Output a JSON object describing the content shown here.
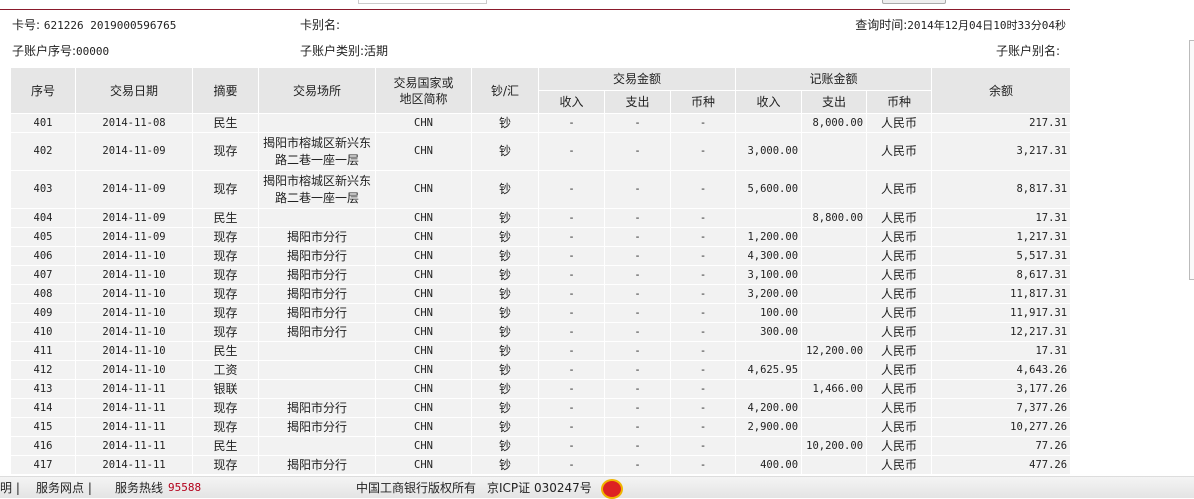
{
  "info": {
    "card_label": "卡号:",
    "card_no": "621226 2019000596765",
    "alias_label": "卡别名:",
    "query_time_label": "查询时间:",
    "query_time": "2014年12月04日10时33分04秒",
    "sub_no_label": "子账户序号:",
    "sub_no": "00000",
    "sub_type_label": "子账户类别:",
    "sub_type": "活期",
    "sub_alias_label": "子账户别名:"
  },
  "headers": {
    "seq": "序号",
    "date": "交易日期",
    "summary": "摘要",
    "place": "交易场所",
    "country": "交易国家或地区简称",
    "cash": "钞/汇",
    "trade_amount": "交易金额",
    "book_amount": "记账金额",
    "balance": "余额",
    "income": "收入",
    "expense": "支出",
    "currency": "币种"
  },
  "rows": [
    [
      "401",
      "2014-11-08",
      "民生",
      "",
      "CHN",
      "钞",
      "-",
      "-",
      "-",
      "",
      "8,000.00",
      "人民币",
      "217.31"
    ],
    [
      "402",
      "2014-11-09",
      "现存",
      "揭阳市榕城区新兴东路二巷一座一层",
      "CHN",
      "钞",
      "-",
      "-",
      "-",
      "3,000.00",
      "",
      "人民币",
      "3,217.31"
    ],
    [
      "403",
      "2014-11-09",
      "现存",
      "揭阳市榕城区新兴东路二巷一座一层",
      "CHN",
      "钞",
      "-",
      "-",
      "-",
      "5,600.00",
      "",
      "人民币",
      "8,817.31"
    ],
    [
      "404",
      "2014-11-09",
      "民生",
      "",
      "CHN",
      "钞",
      "-",
      "-",
      "-",
      "",
      "8,800.00",
      "人民币",
      "17.31"
    ],
    [
      "405",
      "2014-11-09",
      "现存",
      "揭阳市分行",
      "CHN",
      "钞",
      "-",
      "-",
      "-",
      "1,200.00",
      "",
      "人民币",
      "1,217.31"
    ],
    [
      "406",
      "2014-11-10",
      "现存",
      "揭阳市分行",
      "CHN",
      "钞",
      "-",
      "-",
      "-",
      "4,300.00",
      "",
      "人民币",
      "5,517.31"
    ],
    [
      "407",
      "2014-11-10",
      "现存",
      "揭阳市分行",
      "CHN",
      "钞",
      "-",
      "-",
      "-",
      "3,100.00",
      "",
      "人民币",
      "8,617.31"
    ],
    [
      "408",
      "2014-11-10",
      "现存",
      "揭阳市分行",
      "CHN",
      "钞",
      "-",
      "-",
      "-",
      "3,200.00",
      "",
      "人民币",
      "11,817.31"
    ],
    [
      "409",
      "2014-11-10",
      "现存",
      "揭阳市分行",
      "CHN",
      "钞",
      "-",
      "-",
      "-",
      "100.00",
      "",
      "人民币",
      "11,917.31"
    ],
    [
      "410",
      "2014-11-10",
      "现存",
      "揭阳市分行",
      "CHN",
      "钞",
      "-",
      "-",
      "-",
      "300.00",
      "",
      "人民币",
      "12,217.31"
    ],
    [
      "411",
      "2014-11-10",
      "民生",
      "",
      "CHN",
      "钞",
      "-",
      "-",
      "-",
      "",
      "12,200.00",
      "人民币",
      "17.31"
    ],
    [
      "412",
      "2014-11-10",
      "工资",
      "",
      "CHN",
      "钞",
      "-",
      "-",
      "-",
      "4,625.95",
      "",
      "人民币",
      "4,643.26"
    ],
    [
      "413",
      "2014-11-11",
      "银联",
      "",
      "CHN",
      "钞",
      "-",
      "-",
      "-",
      "",
      "1,466.00",
      "人民币",
      "3,177.26"
    ],
    [
      "414",
      "2014-11-11",
      "现存",
      "揭阳市分行",
      "CHN",
      "钞",
      "-",
      "-",
      "-",
      "4,200.00",
      "",
      "人民币",
      "7,377.26"
    ],
    [
      "415",
      "2014-11-11",
      "现存",
      "揭阳市分行",
      "CHN",
      "钞",
      "-",
      "-",
      "-",
      "2,900.00",
      "",
      "人民币",
      "10,277.26"
    ],
    [
      "416",
      "2014-11-11",
      "民生",
      "",
      "CHN",
      "钞",
      "-",
      "-",
      "-",
      "",
      "10,200.00",
      "人民币",
      "77.26"
    ],
    [
      "417",
      "2014-11-11",
      "现存",
      "揭阳市分行",
      "CHN",
      "钞",
      "-",
      "-",
      "-",
      "400.00",
      "",
      "人民币",
      "477.26"
    ]
  ],
  "footer": {
    "statement": "明 |",
    "outlets": "服务网点 |",
    "hotline_label": "服务热线",
    "hotline": "95588",
    "copyright": "中国工商银行版权所有",
    "icp": "京ICP证 030247号"
  }
}
